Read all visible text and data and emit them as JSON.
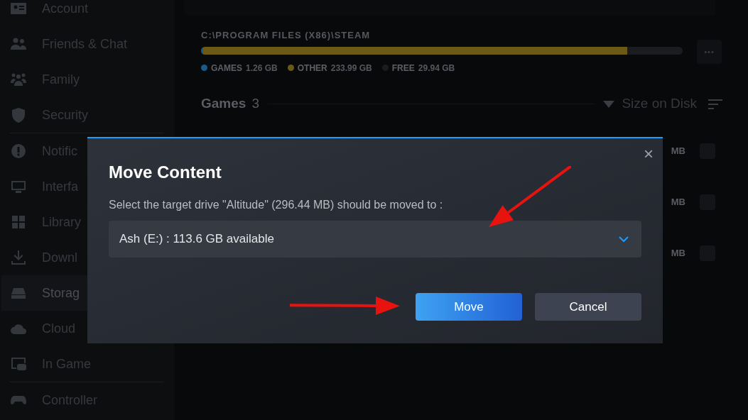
{
  "sidebar": {
    "groups": [
      [
        {
          "label": "Account",
          "selected": false
        },
        {
          "label": "Friends & Chat",
          "selected": false
        },
        {
          "label": "Family",
          "selected": false
        },
        {
          "label": "Security",
          "selected": false
        }
      ],
      [
        {
          "label": "Notific",
          "selected": false
        },
        {
          "label": "Interfa",
          "selected": false
        },
        {
          "label": "Library",
          "selected": false
        },
        {
          "label": "Downl",
          "selected": false
        },
        {
          "label": "Storag",
          "selected": true
        },
        {
          "label": "Cloud",
          "selected": false
        },
        {
          "label": "In Game",
          "selected": false
        }
      ],
      [
        {
          "label": "Controller",
          "selected": false
        }
      ]
    ]
  },
  "storage": {
    "path": "C:\\PROGRAM FILES (X86)\\STEAM",
    "segments": [
      {
        "label": "GAMES",
        "value": "1.26 GB",
        "color": "#1a5a8a",
        "level": 0.005
      },
      {
        "label": "OTHER",
        "value": "233.99 GB",
        "color": "#6b5a17",
        "level": 0.88
      },
      {
        "label": "FREE",
        "value": "29.94 GB",
        "color": "#1a1c20",
        "level": 0.115
      }
    ],
    "more_button": "•••"
  },
  "games": {
    "title": "Games",
    "count": "3",
    "sort_label": "Size on Disk",
    "rows": [
      {
        "size": "MB",
        "checked": false
      },
      {
        "size": "MB",
        "checked": false
      },
      {
        "size": "MB",
        "checked": false
      }
    ]
  },
  "dialog": {
    "title": "Move Content",
    "close": "×",
    "prompt": "Select the target drive \"Altitude\" (296.44 MB) should be moved to :",
    "drive": {
      "value": "Ash (E:) : 113.6 GB available"
    },
    "buttons": [
      {
        "label": "Move",
        "kind": "primary"
      },
      {
        "label": "Cancel",
        "kind": "secondary"
      }
    ]
  }
}
